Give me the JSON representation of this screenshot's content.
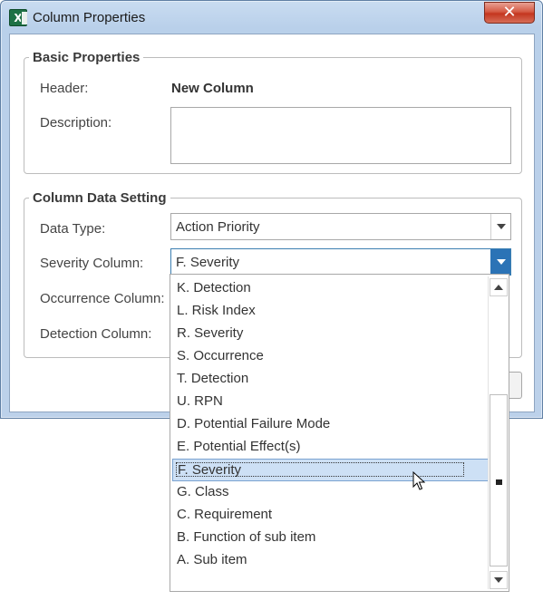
{
  "window": {
    "title": "Column Properties",
    "app_icon_letter": "X",
    "close_glyph": "✕"
  },
  "basic": {
    "legend": "Basic Properties",
    "header_label": "Header:",
    "header_value": "New Column",
    "description_label": "Description:",
    "description_value": ""
  },
  "data_setting": {
    "legend": "Column Data Setting",
    "data_type_label": "Data Type:",
    "data_type_value": "Action Priority",
    "severity_label": "Severity Column:",
    "severity_value": "F. Severity",
    "occurrence_label": "Occurrence Column:",
    "detection_label": "Detection Column:"
  },
  "dropdown": {
    "items": [
      "K. Detection",
      "L. Risk Index",
      "R. Severity",
      "S. Occurrence",
      "T. Detection",
      "U. RPN",
      "D. Potential Failure Mode",
      "E. Potential Effect(s)",
      "F. Severity",
      "G. Class",
      "C. Requirement",
      "B. Function of sub item",
      "A. Sub item"
    ],
    "selected": "F. Severity"
  },
  "colors": {
    "accent": "#2b73b6",
    "selection": "#cde0f5",
    "close": "#c4361f"
  },
  "icons": {
    "app": "excel-icon",
    "close": "close-icon",
    "combo": "chevron-down-icon",
    "scroll_up": "scroll-up-icon",
    "scroll_down": "scroll-down-icon",
    "cursor": "mouse-pointer-icon"
  }
}
